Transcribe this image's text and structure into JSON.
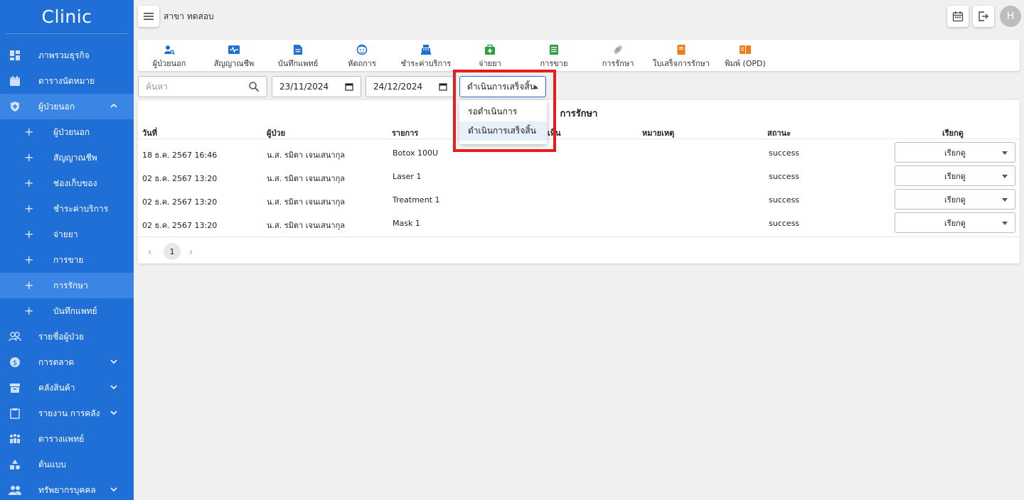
{
  "sidebar": {
    "brand": "Clinic",
    "items": [
      {
        "label": "ภาพรวมธุรกิจ",
        "icon": "dashboard-icon"
      },
      {
        "label": "ตารางนัดหมาย",
        "icon": "calendar-icon"
      },
      {
        "label": "ผู้ป่วยนอก",
        "icon": "shield-icon"
      },
      {
        "label": "ผู้ป่วยนอก"
      },
      {
        "label": "สัญญาณชีพ"
      },
      {
        "label": "ช่องเก็บของ"
      },
      {
        "label": "ชำระค่าบริการ"
      },
      {
        "label": "จ่ายยา"
      },
      {
        "label": "การขาย"
      },
      {
        "label": "การรักษา"
      },
      {
        "label": "บันทึกแพทย์"
      },
      {
        "label": "รายชื่อผู้ป่วย",
        "icon": "patients-icon"
      },
      {
        "label": "การตลาด",
        "icon": "dollar-icon"
      },
      {
        "label": "คลังสินค้า",
        "icon": "warehouse-icon"
      },
      {
        "label": "รายงาน การคลัง",
        "icon": "clipboard-icon"
      },
      {
        "label": "ตารางแพทย์",
        "icon": "doctors-icon"
      },
      {
        "label": "ต้นแบบ",
        "icon": "shapes-icon"
      },
      {
        "label": "ทรัพยากรบุคคล",
        "icon": "people-icon"
      }
    ]
  },
  "topbar": {
    "branch": "สาขา ทดสอบ",
    "avatar_initial": "H"
  },
  "toolbar": {
    "items": [
      {
        "label": "ผู้ป่วยนอก",
        "color": "#1f6fd6"
      },
      {
        "label": "สัญญาณชีพ",
        "color": "#1f6fd6"
      },
      {
        "label": "บันทึกแพทย์",
        "color": "#1f6fd6"
      },
      {
        "label": "หัตถการ",
        "color": "#1f6fd6"
      },
      {
        "label": "ชำระค่าบริการ",
        "color": "#1f6fd6"
      },
      {
        "label": "จ่ายยา",
        "color": "#2e9e3e"
      },
      {
        "label": "การขาย",
        "color": "#2e9e3e"
      },
      {
        "label": "การรักษา",
        "color": "#9e9e9e"
      },
      {
        "label": "ใบเสร็จการรักษา",
        "color": "#ef7b1a"
      },
      {
        "label": "พิมพ์ (OPD)",
        "color": "#ef7b1a"
      }
    ]
  },
  "filters": {
    "search_placeholder": "ค้นหา",
    "date_from": "23/11/2024",
    "date_to": "24/12/2024",
    "status_value": "ดำเนินการเสร็จสิ้น"
  },
  "dropdown": {
    "options": [
      "รอดำเนินการ",
      "ดำเนินการเสร็จสิ้น"
    ],
    "selected": 1
  },
  "table": {
    "title": "การรักษา",
    "headers": [
      "วันที่",
      "ผู้ป่วย",
      "รายการ",
      "เห็น",
      "หมายเหตุ",
      "สถานะ",
      "เรียกดู"
    ],
    "rows": [
      {
        "date": "18 ธ.ค. 2567 16:46",
        "patient": "น.ส. รมิตา เจนเสนากุล",
        "item": "Botox 100U",
        "status": "success",
        "action": "เรียกดู"
      },
      {
        "date": "02 ธ.ค. 2567 13:20",
        "patient": "น.ส. รมิตา เจนเสนากุล",
        "item": "Laser 1",
        "status": "success",
        "action": "เรียกดู"
      },
      {
        "date": "02 ธ.ค. 2567 13:20",
        "patient": "น.ส. รมิตา เจนเสนากุล",
        "item": "Treatment 1",
        "status": "success",
        "action": "เรียกดู"
      },
      {
        "date": "02 ธ.ค. 2567 13:20",
        "patient": "น.ส. รมิตา เจนเสนากุล",
        "item": "Mask 1",
        "status": "success",
        "action": "เรียกดู"
      }
    ],
    "page": "1"
  },
  "colors": {
    "sidebar": "#1f6fd6",
    "highlight": "#e81c1c"
  }
}
